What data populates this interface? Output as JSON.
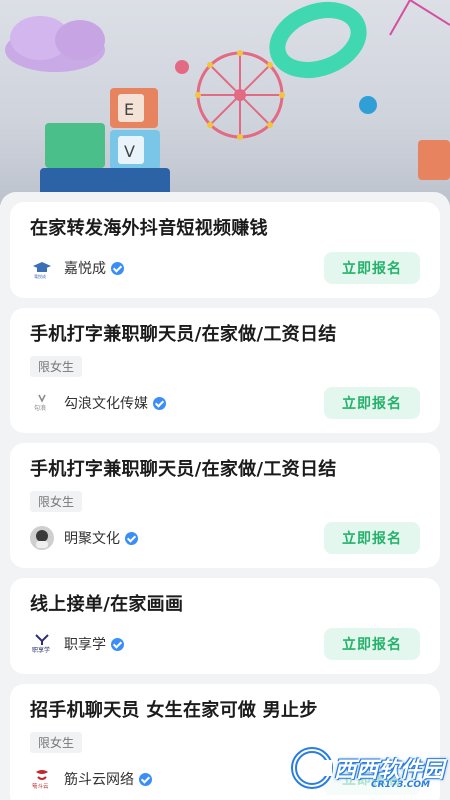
{
  "jobs": [
    {
      "title": "在家转发海外抖音短视频赚钱",
      "tag": "",
      "company": "嘉悦成",
      "logo_text": "嘉悦成",
      "logo_color": "#3b6fb6",
      "button": "立即报名"
    },
    {
      "title": "手机打字兼职聊天员/在家做/工资日结",
      "tag": "限女生",
      "company": "勾浪文化传媒",
      "logo_text": "勾浪",
      "logo_color": "#888888",
      "button": "立即报名"
    },
    {
      "title": "手机打字兼职聊天员/在家做/工资日结",
      "tag": "限女生",
      "company": "明聚文化",
      "logo_text": "",
      "logo_color": "#555555",
      "button": "立即报名"
    },
    {
      "title": "线上接单/在家画画",
      "tag": "",
      "company": "职享学",
      "logo_text": "职享学",
      "logo_color": "#2b2f6e",
      "button": "立即报名"
    },
    {
      "title": "招手机聊天员 女生在家可做 男止步",
      "tag": "限女生",
      "company": "筋斗云网络",
      "logo_text": "筋斗云",
      "logo_color": "#c0282d",
      "button": "立即报名"
    }
  ],
  "watermark": {
    "text": "西西软件园",
    "sub": "CR173.COM"
  },
  "colors": {
    "accent": "#24b26b",
    "accent_bg": "#e4f7ee",
    "verified": "#3b8ef5"
  }
}
